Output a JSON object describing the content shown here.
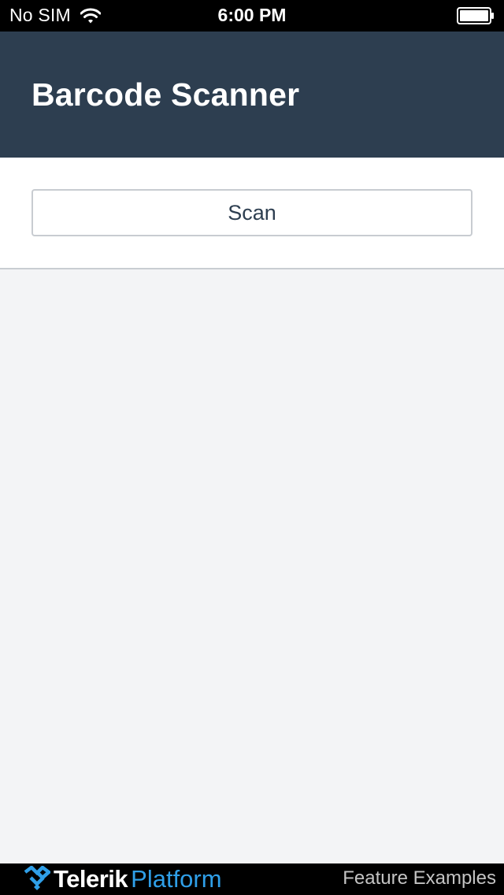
{
  "status_bar": {
    "carrier": "No SIM",
    "time": "6:00 PM",
    "wifi_icon": "wifi-icon",
    "battery_icon": "battery-full-icon"
  },
  "header": {
    "title": "Barcode Scanner",
    "background_color": "#2d3e50"
  },
  "main": {
    "scan_button_label": "Scan"
  },
  "footer": {
    "brand": "Telerik",
    "product": "Platform",
    "link": "Feature Examples",
    "logo_icon": "telerik-logo-icon",
    "accent_color": "#2f9fe8"
  }
}
